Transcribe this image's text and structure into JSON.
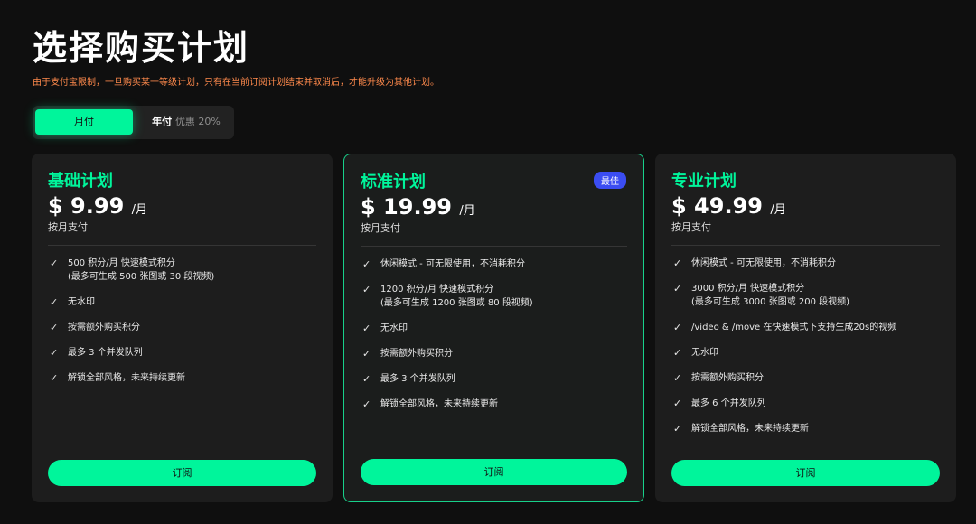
{
  "page": {
    "title": "选择购买计划",
    "notice": "由于支付宝限制，一旦购买某一等级计划，只有在当前订阅计划结束并取消后，才能升级为其他计划。"
  },
  "billing_toggle": {
    "monthly": "月付",
    "yearly": "年付",
    "yearly_discount": "优惠 20%",
    "selected": "monthly"
  },
  "colors": {
    "accent": "#00f59b",
    "badge": "#3b4df2",
    "notice": "#ff8a4c"
  },
  "plans": [
    {
      "name": "基础计划",
      "price": "$ 9.99",
      "unit": "/月",
      "billing": "按月支付",
      "badge": "",
      "features": [
        {
          "text": "500 积分/月 快速模式积分",
          "sub": "(最多可生成 500 张图或 30 段视频)"
        },
        {
          "text": "无水印",
          "sub": ""
        },
        {
          "text": "按需额外购买积分",
          "sub": ""
        },
        {
          "text": "最多 3 个并发队列",
          "sub": ""
        },
        {
          "text": "解锁全部风格，未来持续更新",
          "sub": ""
        }
      ],
      "cta": "订阅"
    },
    {
      "name": "标准计划",
      "price": "$ 19.99",
      "unit": "/月",
      "billing": "按月支付",
      "badge": "最佳",
      "features": [
        {
          "text": "休闲模式 - 可无限使用，不消耗积分",
          "sub": ""
        },
        {
          "text": "1200 积分/月 快速模式积分",
          "sub": "(最多可生成 1200 张图或 80 段视频)"
        },
        {
          "text": "无水印",
          "sub": ""
        },
        {
          "text": "按需额外购买积分",
          "sub": ""
        },
        {
          "text": "最多 3 个并发队列",
          "sub": ""
        },
        {
          "text": "解锁全部风格，未来持续更新",
          "sub": ""
        }
      ],
      "cta": "订阅"
    },
    {
      "name": "专业计划",
      "price": "$ 49.99",
      "unit": "/月",
      "billing": "按月支付",
      "badge": "",
      "features": [
        {
          "text": "休闲模式 - 可无限使用，不消耗积分",
          "sub": ""
        },
        {
          "text": "3000 积分/月 快速模式积分",
          "sub": "(最多可生成 3000 张图或 200 段视频)"
        },
        {
          "text": "/video & /move 在快速模式下支持生成20s的视频",
          "sub": ""
        },
        {
          "text": "无水印",
          "sub": ""
        },
        {
          "text": "按需额外购买积分",
          "sub": ""
        },
        {
          "text": "最多 6 个并发队列",
          "sub": ""
        },
        {
          "text": "解锁全部风格，未来持续更新",
          "sub": ""
        }
      ],
      "cta": "订阅"
    }
  ]
}
